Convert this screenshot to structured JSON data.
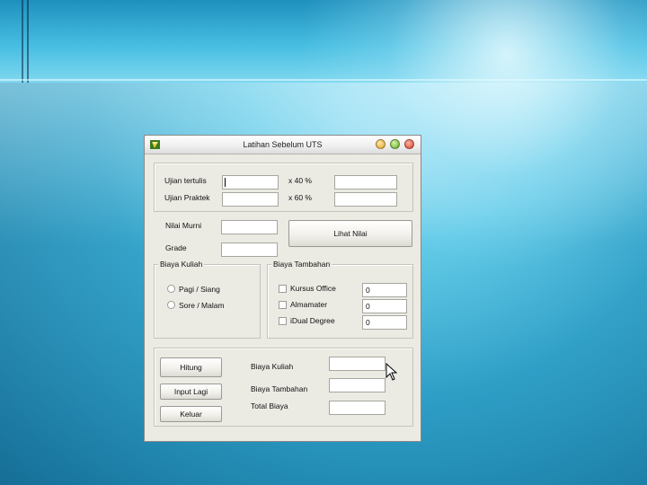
{
  "window": {
    "title": "Latihan Sebelum UTS"
  },
  "exam": {
    "tertulis_label": "Ujian tertulis",
    "praktek_label": "Ujian Praktek",
    "tertulis_weight": "x 40 %",
    "praktek_weight": "x 60 %"
  },
  "grade": {
    "nilai_murni_label": "Nilai Murni",
    "grade_label": "Grade",
    "lihat_button": "Lihat Nilai"
  },
  "biaya_kuliah": {
    "title": "Biaya Kuliah",
    "options": [
      "Pagi / Siang",
      "Sore / Malam"
    ]
  },
  "biaya_tambahan": {
    "title": "Biaya Tambahan",
    "items": [
      {
        "label": "Kursus Office",
        "value": "0"
      },
      {
        "label": "Almamater",
        "value": "0"
      },
      {
        "label": "iDual Degree",
        "value": "0"
      }
    ]
  },
  "actions": {
    "hitung": "Hitung",
    "input_lagi": "Input Lagi",
    "keluar": "Keluar"
  },
  "totals": {
    "biaya_kuliah_label": "Biaya Kuliah",
    "biaya_tambahan_label": "Biaya Tambahan",
    "total_label": "Total Biaya"
  }
}
